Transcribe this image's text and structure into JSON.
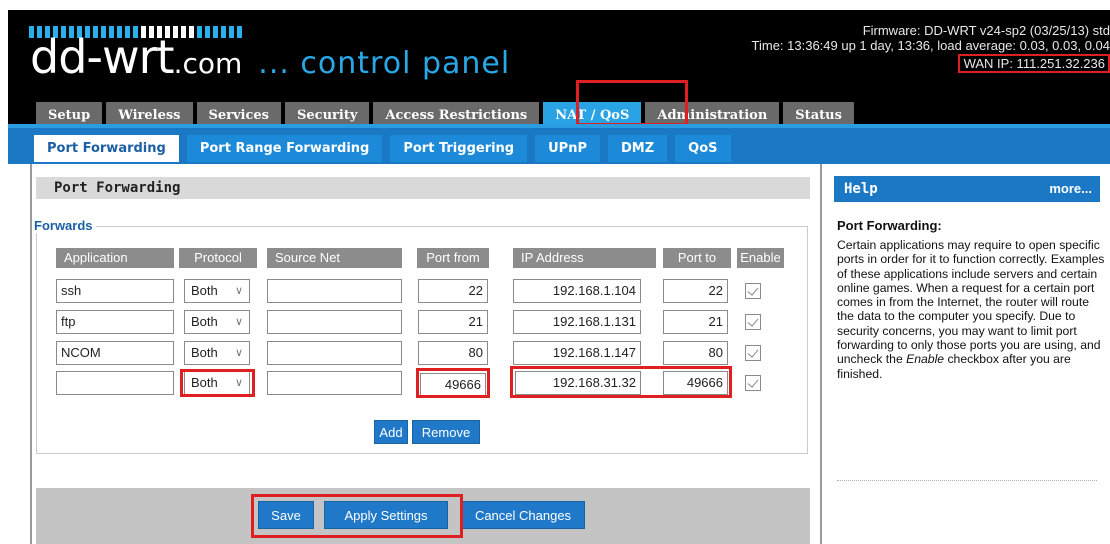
{
  "header": {
    "logo_main": "dd-wrt",
    "logo_suffix": ".com",
    "logo_tagline": "... control panel",
    "firmware": "Firmware: DD-WRT v24-sp2 (03/25/13) std",
    "time": "Time: 13:36:49 up 1 day, 13:36, load average: 0.03, 0.03, 0.04",
    "wan_ip": "WAN IP: 111.251.32.236"
  },
  "main_tabs": [
    "Setup",
    "Wireless",
    "Services",
    "Security",
    "Access Restrictions",
    "NAT / QoS",
    "Administration",
    "Status"
  ],
  "main_tabs_active": "NAT / QoS",
  "sub_tabs": [
    "Port Forwarding",
    "Port Range Forwarding",
    "Port Triggering",
    "UPnP",
    "DMZ",
    "QoS"
  ],
  "sub_tabs_active": "Port Forwarding",
  "section_title": "Port Forwarding",
  "forwards": {
    "legend": "Forwards",
    "columns": [
      "Application",
      "Protocol",
      "Source Net",
      "Port from",
      "IP Address",
      "Port to",
      "Enable"
    ],
    "rows": [
      {
        "application": "ssh",
        "protocol": "Both",
        "source_net": "",
        "port_from": "22",
        "ip": "192.168.1.104",
        "port_to": "22",
        "enabled": true
      },
      {
        "application": "ftp",
        "protocol": "Both",
        "source_net": "",
        "port_from": "21",
        "ip": "192.168.1.131",
        "port_to": "21",
        "enabled": true
      },
      {
        "application": "NCOM",
        "protocol": "Both",
        "source_net": "",
        "port_from": "80",
        "ip": "192.168.1.147",
        "port_to": "80",
        "enabled": true
      },
      {
        "application": "",
        "protocol": "Both",
        "source_net": "",
        "port_from": "49666",
        "ip": "192.168.31.32",
        "port_to": "49666",
        "enabled": true
      }
    ],
    "add_label": "Add",
    "remove_label": "Remove"
  },
  "actions": {
    "save": "Save",
    "apply": "Apply Settings",
    "cancel": "Cancel Changes"
  },
  "help": {
    "title": "Help",
    "more": "more...",
    "heading": "Port Forwarding:",
    "body_1": "Certain applications may require to open specific ports in order for it to function correctly. Examples of these applications include servers and certain online games. When a request for a certain port comes in from the Internet, the router will route the data to the computer you specify. Due to security concerns, you may want to limit port forwarding to only those ports you are using, and uncheck the ",
    "body_em": "Enable",
    "body_2": " checkbox after you are finished."
  },
  "colors": {
    "header_bg": "#000000",
    "tab_active": "#29a3e4",
    "subbar_bg": "#1b78c5",
    "button_bg": "#1f79c8",
    "highlight_red": "#e02020"
  }
}
